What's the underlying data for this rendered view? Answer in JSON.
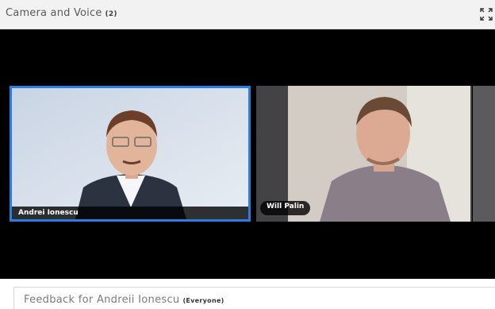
{
  "panel": {
    "title": "Camera and Voice",
    "count": "(2)",
    "expand_icon": "expand-icon"
  },
  "participants": [
    {
      "name": "Andrei Ionescu",
      "active_speaker": true
    },
    {
      "name": "Will Palin",
      "active_speaker": false
    }
  ],
  "feedback": {
    "title": "Feedback for Andreii Ionescu",
    "audience": "(Everyone)"
  },
  "colors": {
    "active_border": "#2a7de1",
    "stage_bg": "#000000"
  }
}
